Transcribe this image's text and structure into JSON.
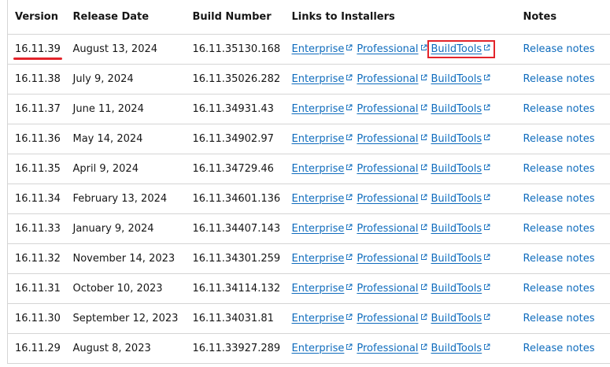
{
  "headers": {
    "version": "Version",
    "release_date": "Release Date",
    "build_number": "Build Number",
    "links": "Links to Installers",
    "notes": "Notes"
  },
  "link_labels": {
    "enterprise": "Enterprise",
    "professional": "Professional",
    "buildtools": "BuildTools",
    "release_notes": "Release notes"
  },
  "rows": [
    {
      "version": "16.11.39",
      "date": "August 13, 2024",
      "build": "16.11.35130.168"
    },
    {
      "version": "16.11.38",
      "date": "July 9, 2024",
      "build": "16.11.35026.282"
    },
    {
      "version": "16.11.37",
      "date": "June 11, 2024",
      "build": "16.11.34931.43"
    },
    {
      "version": "16.11.36",
      "date": "May 14, 2024",
      "build": "16.11.34902.97"
    },
    {
      "version": "16.11.35",
      "date": "April 9, 2024",
      "build": "16.11.34729.46"
    },
    {
      "version": "16.11.34",
      "date": "February 13, 2024",
      "build": "16.11.34601.136"
    },
    {
      "version": "16.11.33",
      "date": "January 9, 2024",
      "build": "16.11.34407.143"
    },
    {
      "version": "16.11.32",
      "date": "November 14, 2023",
      "build": "16.11.34301.259"
    },
    {
      "version": "16.11.31",
      "date": "October 10, 2023",
      "build": "16.11.34114.132"
    },
    {
      "version": "16.11.30",
      "date": "September 12, 2023",
      "build": "16.11.34031.81"
    },
    {
      "version": "16.11.29",
      "date": "August 8, 2023",
      "build": "16.11.33927.289"
    }
  ],
  "colors": {
    "link": "#0f6cbd",
    "highlight": "#e3242b",
    "border": "#d5d5d5"
  },
  "icons": {
    "external_link": "external-link-icon"
  }
}
